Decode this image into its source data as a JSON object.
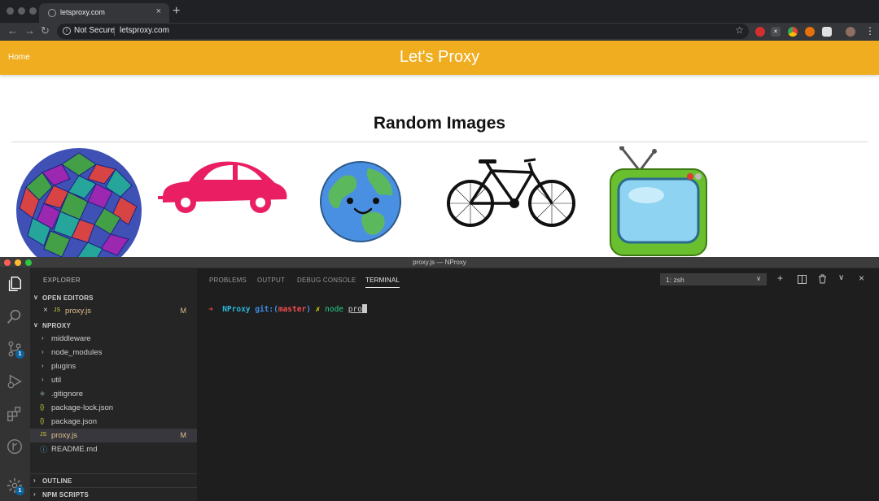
{
  "browser": {
    "tab_title": "letsproxy.com",
    "tab_close": "×",
    "new_tab": "+",
    "back": "←",
    "forward": "→",
    "reload": "↻",
    "security_label": "Not Secure",
    "url": "letsproxy.com",
    "bookmark": "☆",
    "menu": "⋮"
  },
  "site": {
    "home_link": "Home",
    "brand": "Let's Proxy",
    "heading": "Random Images",
    "images": [
      "rhombic-sphere-image",
      "beetle-car-image",
      "earth-image",
      "bicycle-image",
      "tv-image"
    ],
    "header_color": "#efad1f"
  },
  "vscode": {
    "window_title": "proxy.js — NProxy",
    "scm_badge": "1",
    "settings_badge": "1",
    "explorer_title": "EXPLORER",
    "open_editors": {
      "label": "OPEN EDITORS",
      "items": [
        {
          "close": "×",
          "type": "JS",
          "name": "proxy.js",
          "status": "M"
        }
      ]
    },
    "project": {
      "label": "NPROXY",
      "folders": [
        "middleware",
        "node_modules",
        "plugins",
        "util"
      ],
      "files": [
        {
          "icon": "◈",
          "name": ".gitignore",
          "status": ""
        },
        {
          "icon": "{}",
          "name": "package-lock.json",
          "status": ""
        },
        {
          "icon": "{}",
          "name": "package.json",
          "status": ""
        },
        {
          "icon": "JS",
          "name": "proxy.js",
          "status": "M"
        },
        {
          "icon": "ⓘ",
          "name": "README.md",
          "status": ""
        }
      ]
    },
    "outline_label": "OUTLINE",
    "npm_scripts_label": "NPM SCRIPTS",
    "panel_tabs": [
      "PROBLEMS",
      "OUTPUT",
      "DEBUG CONSOLE",
      "TERMINAL"
    ],
    "active_tab": "TERMINAL",
    "terminal_select": "1: zsh",
    "terminal": {
      "arrow": "➜",
      "dir": "NProxy",
      "git_prefix": "git:(",
      "branch": "master",
      "git_suffix": ")",
      "dirty": "✗",
      "command": "node",
      "arg": "pro",
      "cursor": "x"
    }
  }
}
